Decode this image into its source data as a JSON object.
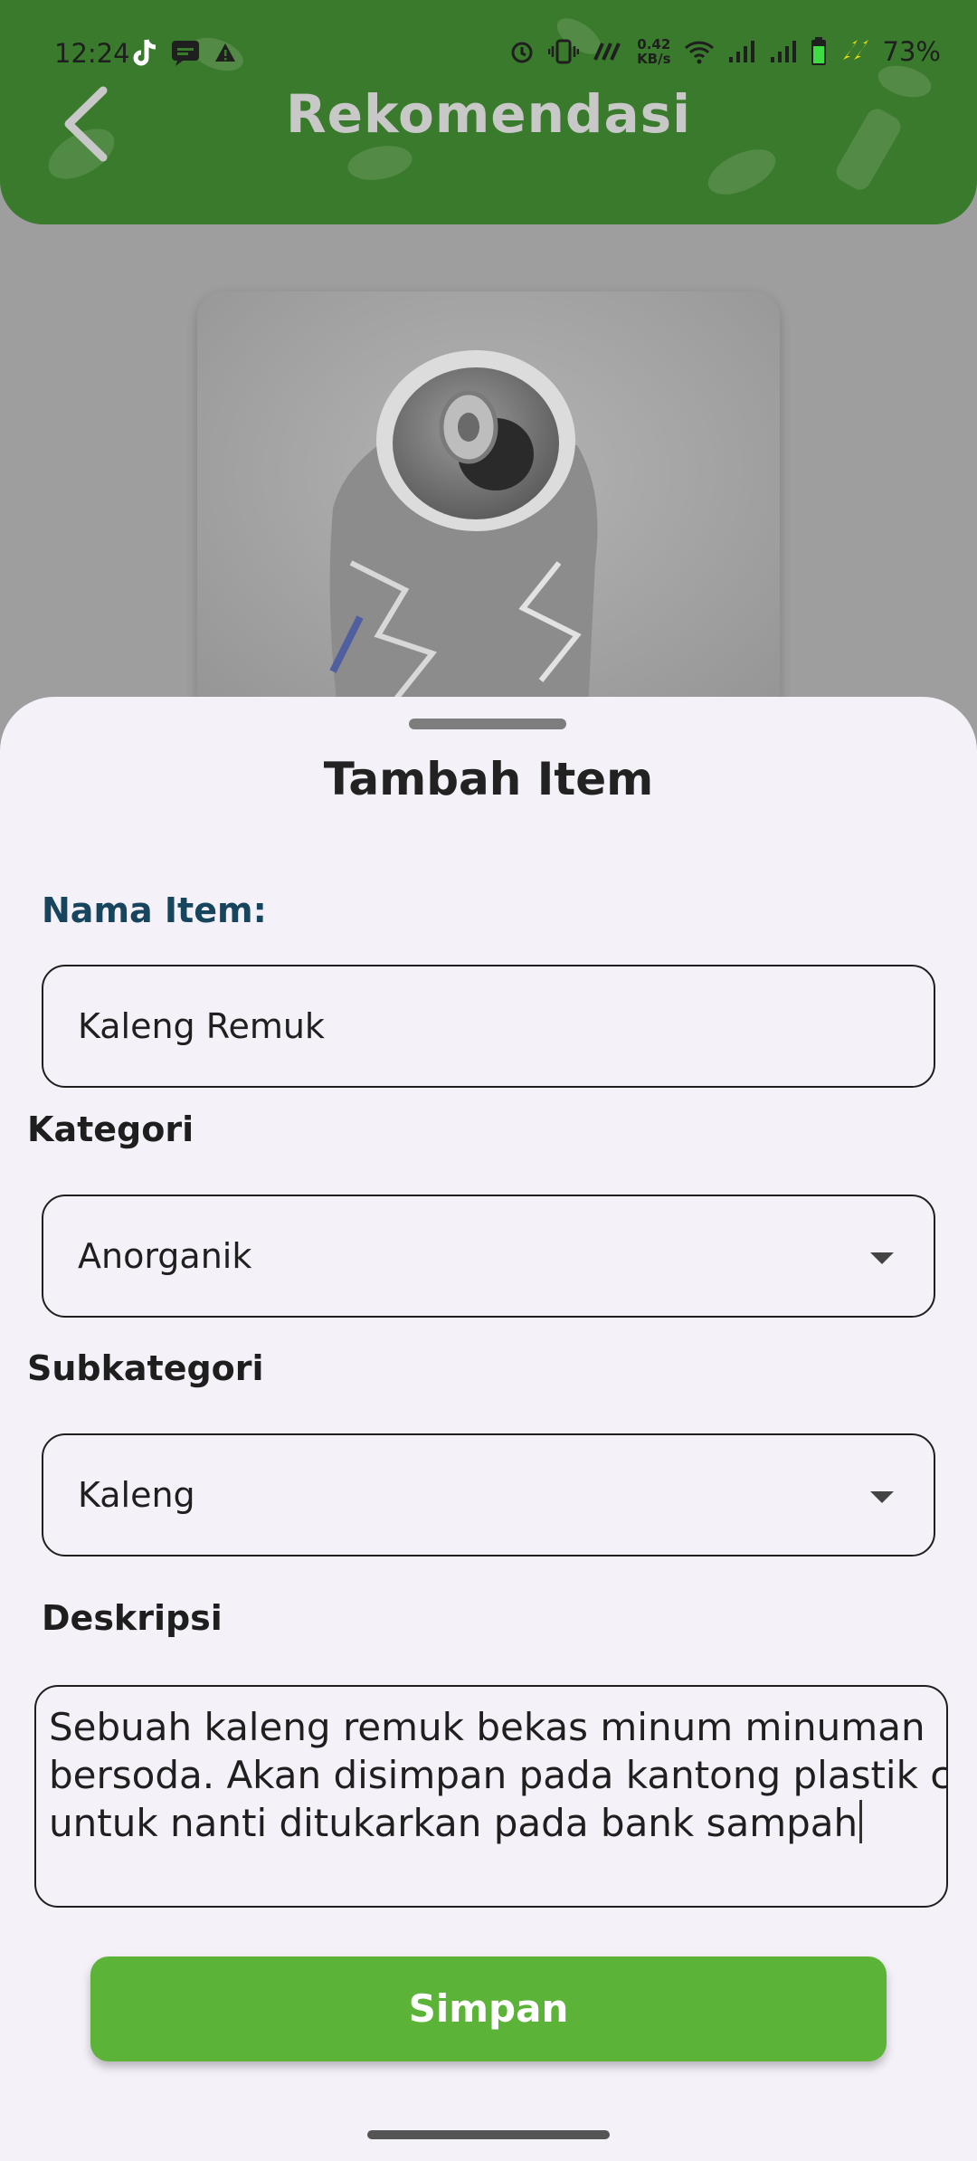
{
  "status_bar": {
    "time": "12:24",
    "speed_value": "0.42",
    "speed_unit": "KB/s",
    "battery_percent": "73%",
    "icons": [
      "tiktok-icon",
      "webtoon-icon",
      "warning-icon",
      "alarm-icon",
      "vibrate-icon",
      "network-icon",
      "wifi-icon",
      "signal-icon",
      "signal-icon",
      "battery-icon",
      "charging-icon"
    ]
  },
  "app_bar": {
    "title": "Rekomendasi",
    "back_icon": "chevron-left-icon"
  },
  "sheet": {
    "title": "Tambah Item",
    "nama_item": {
      "label": "Nama Item:",
      "value": "Kaleng Remuk"
    },
    "kategori": {
      "label": "Kategori",
      "value": "Anorganik"
    },
    "subkategori": {
      "label": "Subkategori",
      "value": "Kaleng"
    },
    "deskripsi": {
      "label": "Deskripsi",
      "lines": [
        "Sebuah kaleng remuk bekas minum minuman",
        "bersoda. Akan disimpan pada kantong plastik c",
        "untuk nanti ditukarkan pada bank sampah"
      ]
    },
    "save_label": "Simpan"
  },
  "colors": {
    "app_bar": "#3a7a2c",
    "primary_button": "#5bb337",
    "sheet_bg": "#f5f1f9",
    "label_blue": "#17455d"
  }
}
